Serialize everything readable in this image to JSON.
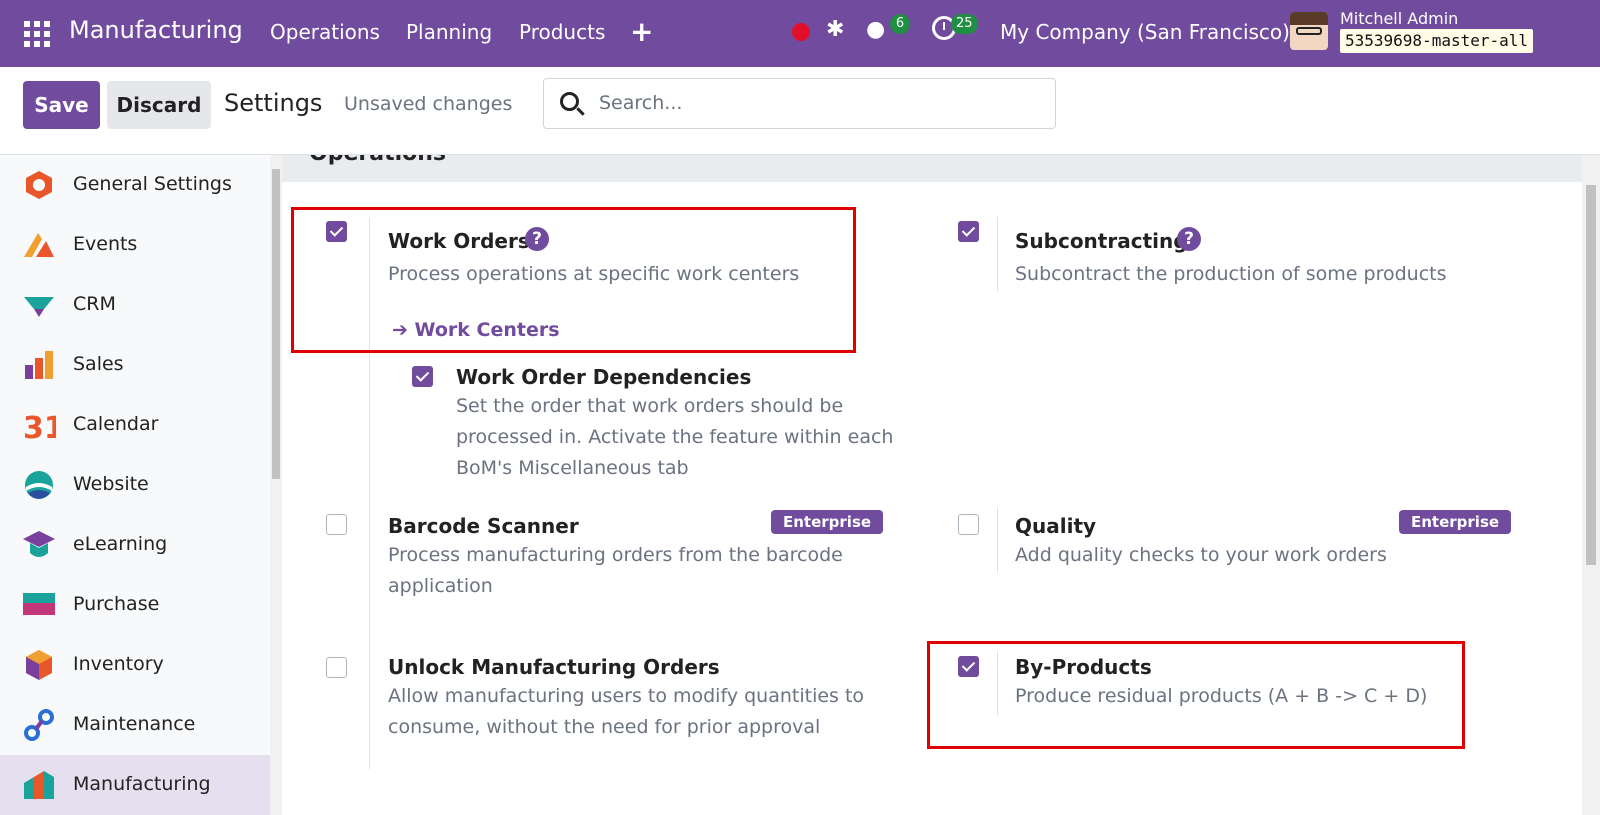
{
  "navbar": {
    "app_name": "Manufacturing",
    "menus": [
      "Operations",
      "Planning",
      "Products"
    ],
    "plus_label": "+",
    "chat_count": "6",
    "activity_count": "25",
    "company": "My Company (San Francisco)",
    "user_name": "Mitchell Admin",
    "database": "53539698-master-all"
  },
  "control": {
    "save_label": "Save",
    "discard_label": "Discard",
    "title": "Settings",
    "unsaved": "Unsaved changes",
    "search_placeholder": "Search..."
  },
  "sidebar": {
    "items": [
      {
        "label": "General Settings",
        "icon": "general-settings-icon"
      },
      {
        "label": "Events",
        "icon": "events-icon"
      },
      {
        "label": "CRM",
        "icon": "crm-icon"
      },
      {
        "label": "Sales",
        "icon": "sales-icon"
      },
      {
        "label": "Calendar",
        "icon": "calendar-icon",
        "icon_text": "31"
      },
      {
        "label": "Website",
        "icon": "website-icon"
      },
      {
        "label": "eLearning",
        "icon": "elearning-icon"
      },
      {
        "label": "Purchase",
        "icon": "purchase-icon"
      },
      {
        "label": "Inventory",
        "icon": "inventory-icon"
      },
      {
        "label": "Maintenance",
        "icon": "maintenance-icon"
      },
      {
        "label": "Manufacturing",
        "icon": "manufacturing-icon",
        "active": true
      }
    ]
  },
  "section": {
    "title": "Operations"
  },
  "settings": {
    "work_orders": {
      "title": "Work Orders",
      "desc": "Process operations at specific work centers",
      "link": "Work Centers",
      "checked": true
    },
    "subcontracting": {
      "title": "Subcontracting",
      "desc": "Subcontract the production of some products",
      "checked": true
    },
    "wo_dependencies": {
      "title": "Work Order Dependencies",
      "desc_lines": [
        "Set the order that work orders should be",
        "processed in. Activate the feature within each",
        "BoM's Miscellaneous tab"
      ],
      "checked": true
    },
    "barcode": {
      "title": "Barcode Scanner",
      "badge": "Enterprise",
      "desc_lines": [
        "Process manufacturing orders from the barcode",
        "application"
      ],
      "checked": false
    },
    "quality": {
      "title": "Quality",
      "badge": "Enterprise",
      "desc": "Add quality checks to your work orders",
      "checked": false
    },
    "unlock_mo": {
      "title": "Unlock Manufacturing Orders",
      "desc_lines": [
        "Allow manufacturing users to modify quantities to",
        "consume, without the need for prior approval"
      ],
      "checked": false
    },
    "by_products": {
      "title": "By-Products",
      "desc": "Produce residual products (A + B -> C + D)",
      "checked": true
    }
  },
  "colors": {
    "brand": "#714B9E",
    "highlight": "#e00000"
  }
}
